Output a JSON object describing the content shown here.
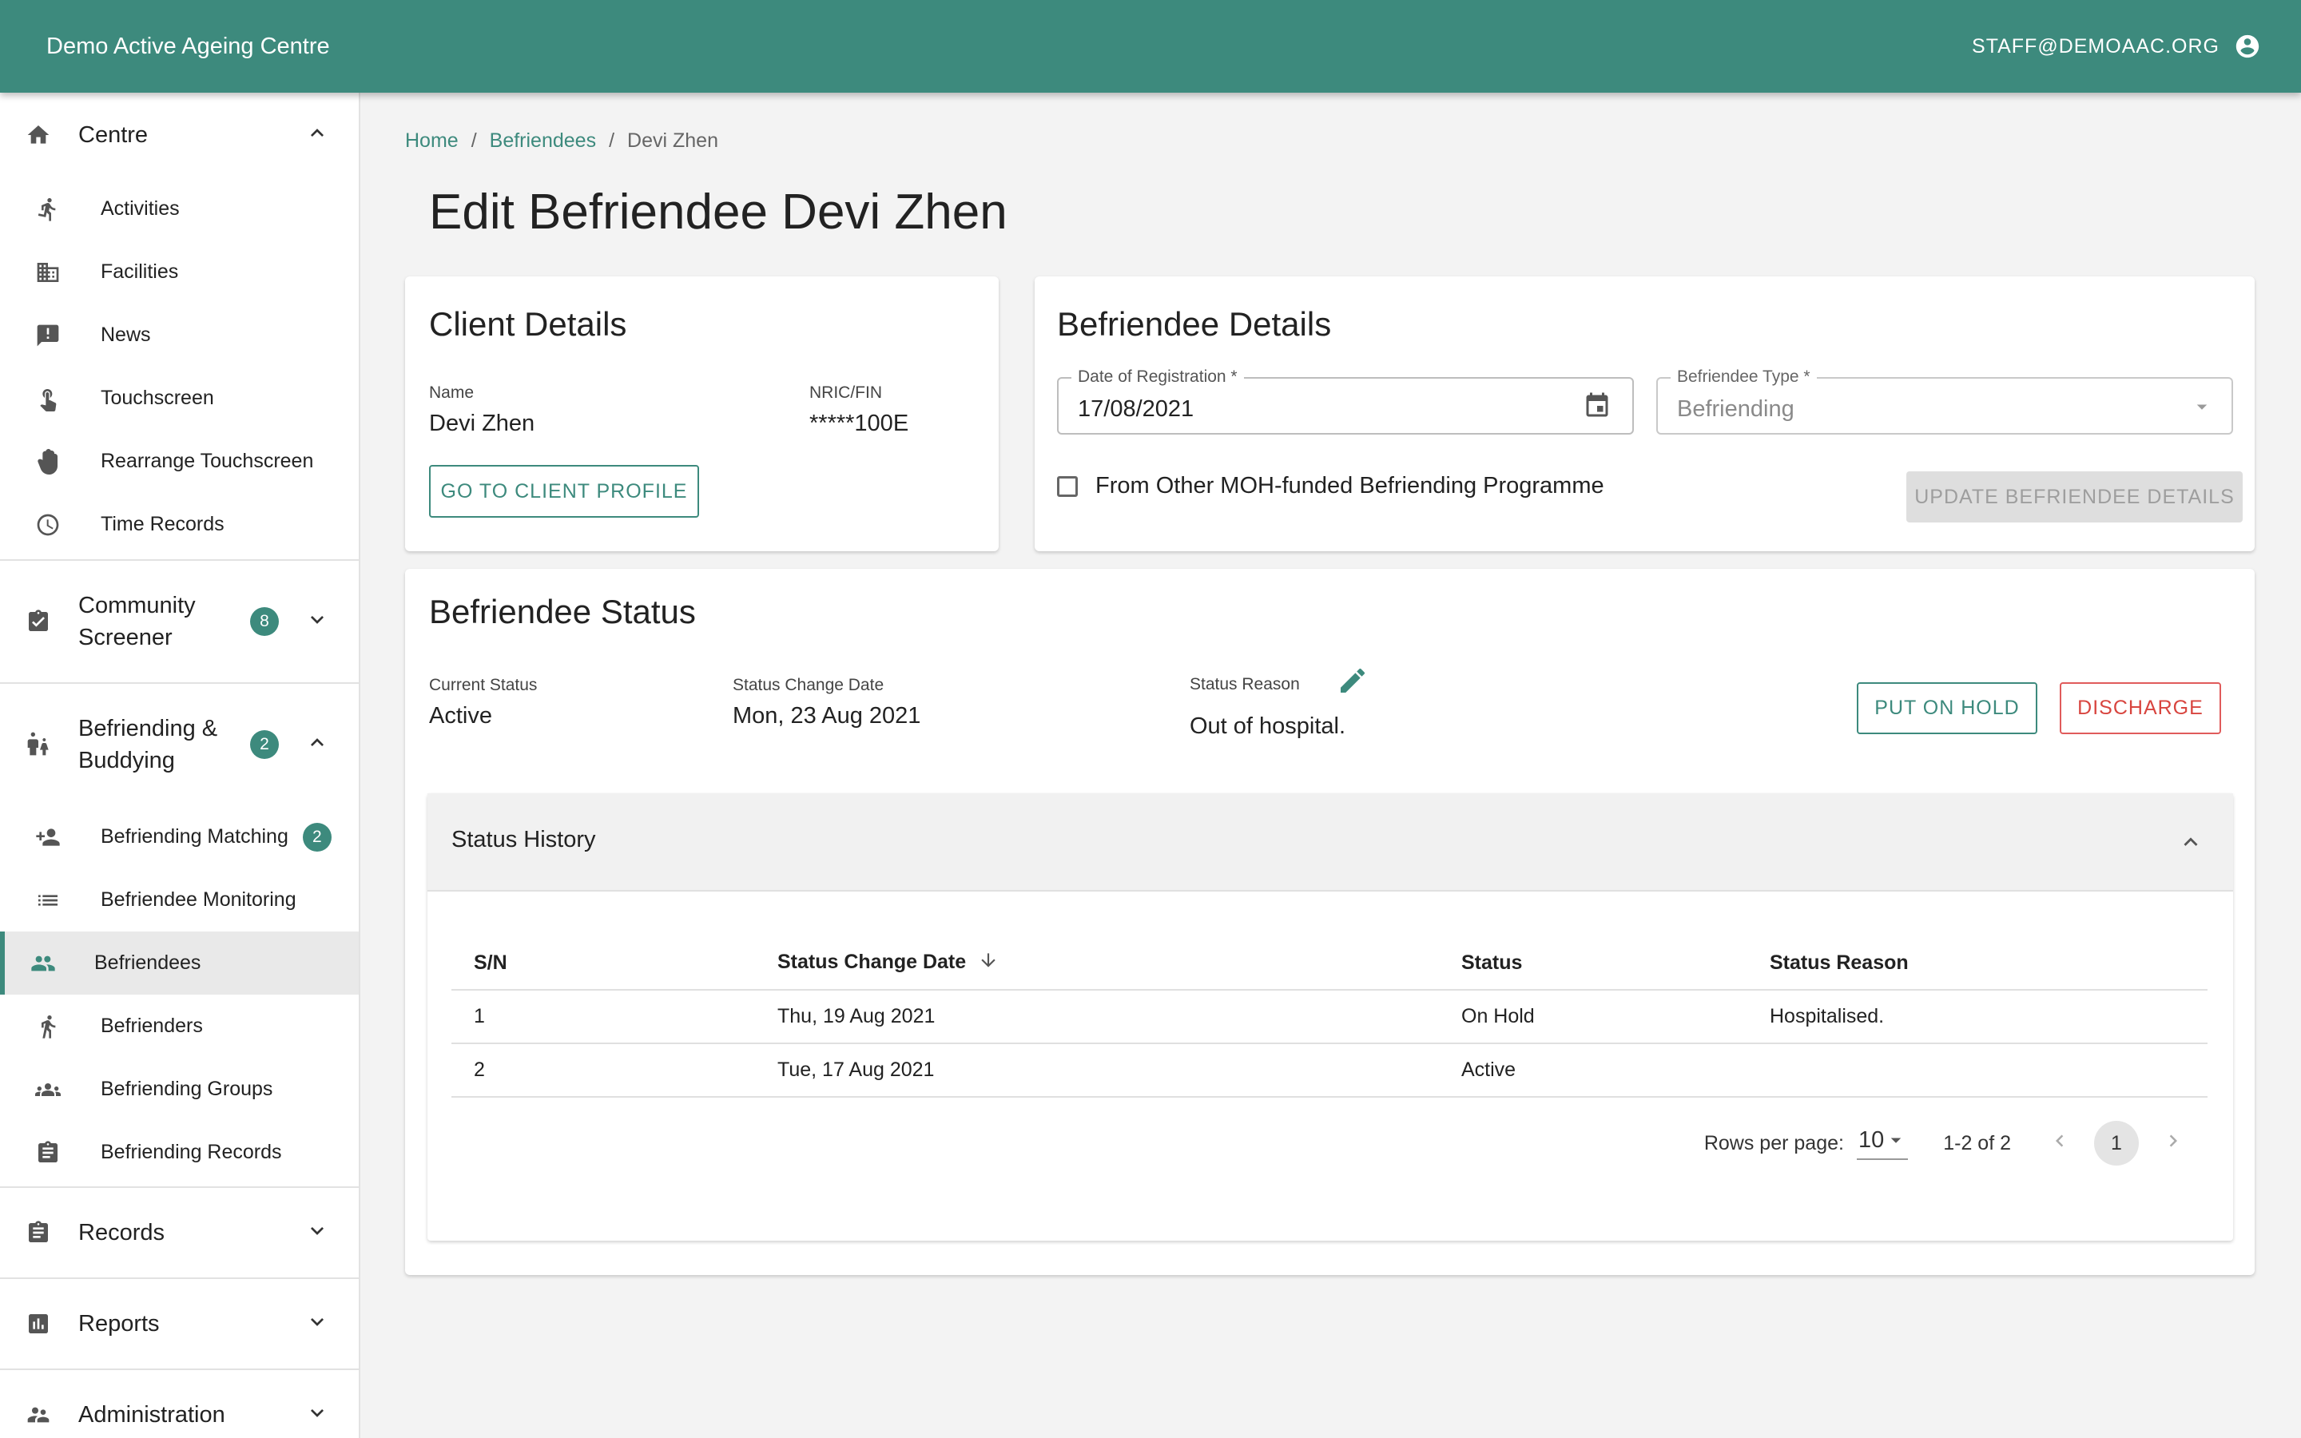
{
  "app": {
    "title": "Demo Active Ageing Centre",
    "user_email": "STAFF@DEMOAAC.ORG"
  },
  "sidebar": {
    "centre": {
      "label": "Centre",
      "items": [
        {
          "label": "Activities",
          "icon": "run-icon"
        },
        {
          "label": "Facilities",
          "icon": "building-icon"
        },
        {
          "label": "News",
          "icon": "announcement-icon"
        },
        {
          "label": "Touchscreen",
          "icon": "touch-icon"
        },
        {
          "label": "Rearrange Touchscreen",
          "icon": "hand-icon"
        },
        {
          "label": "Time Records",
          "icon": "clock-icon"
        }
      ]
    },
    "community": {
      "label_line1": "Community",
      "label_line2": "Screener",
      "badge": "8"
    },
    "befriending": {
      "label_line1": "Befriending &",
      "label_line2": "Buddying",
      "badge": "2",
      "items": [
        {
          "label": "Befriending Matching",
          "badge": "2"
        },
        {
          "label": "Befriendee Monitoring"
        },
        {
          "label": "Befriendees"
        },
        {
          "label": "Befrienders"
        },
        {
          "label": "Befriending Groups"
        },
        {
          "label": "Befriending Records"
        }
      ]
    },
    "records": {
      "label": "Records"
    },
    "reports": {
      "label": "Reports"
    },
    "administration": {
      "label": "Administration"
    }
  },
  "breadcrumb": {
    "home": "Home",
    "section": "Befriendees",
    "sep": "/",
    "current": "Devi Zhen"
  },
  "page_title": "Edit Befriendee Devi Zhen",
  "client_details": {
    "title": "Client Details",
    "name_label": "Name",
    "name_value": "Devi Zhen",
    "nric_label": "NRIC/FIN",
    "nric_value": "*****100E",
    "profile_button": "GO TO CLIENT PROFILE"
  },
  "befriendee_details": {
    "title": "Befriendee Details",
    "date_label": "Date of Registration *",
    "date_value": "17/08/2021",
    "type_label": "Befriendee Type *",
    "type_value": "Befriending",
    "checkbox_label": "From Other MOH-funded Befriending Programme",
    "update_button": "UPDATE BEFRIENDEE DETAILS"
  },
  "status": {
    "title": "Befriendee Status",
    "current_label": "Current Status",
    "current_value": "Active",
    "change_label": "Status Change Date",
    "change_value": "Mon, 23 Aug 2021",
    "reason_label": "Status Reason",
    "reason_value": "Out of hospital.",
    "hold_button": "PUT ON HOLD",
    "discharge_button": "DISCHARGE"
  },
  "history": {
    "title": "Status History",
    "columns": {
      "sn": "S/N",
      "date": "Status Change Date",
      "status": "Status",
      "reason": "Status Reason"
    },
    "rows": [
      {
        "sn": "1",
        "date": "Thu, 19 Aug 2021",
        "status": "On Hold",
        "reason": "Hospitalised."
      },
      {
        "sn": "2",
        "date": "Tue, 17 Aug 2021",
        "status": "Active",
        "reason": ""
      }
    ],
    "rows_per_page_label": "Rows per page:",
    "rows_per_page": "10",
    "range": "1-2 of 2",
    "page": "1"
  },
  "colors": {
    "primary": "#3d8a7d",
    "danger": "#d8453f"
  }
}
